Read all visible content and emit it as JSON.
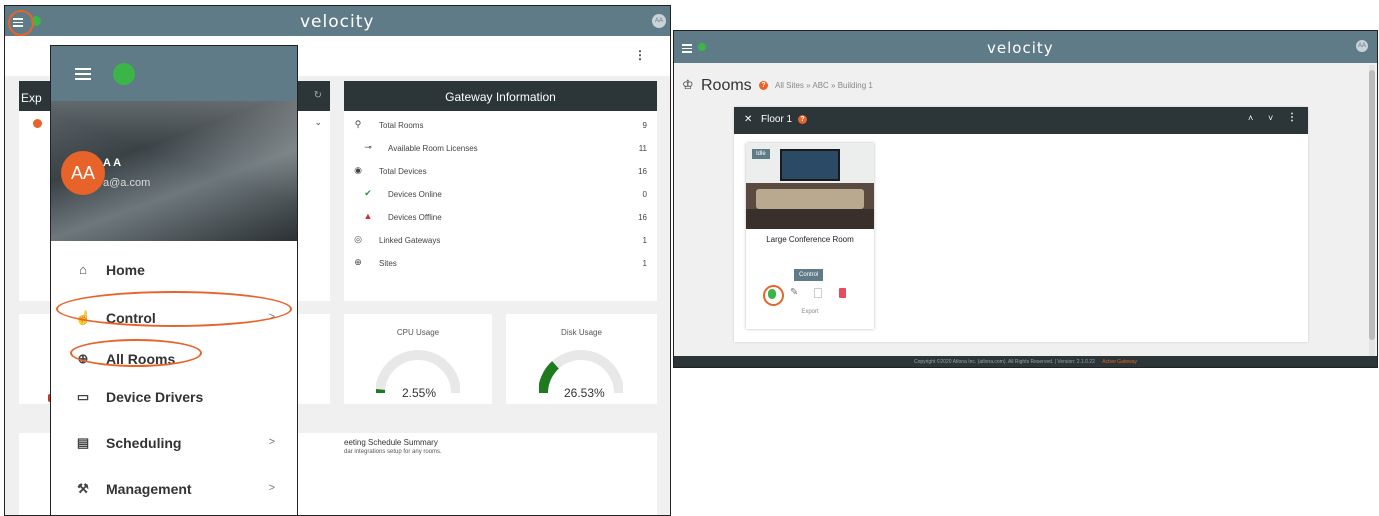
{
  "left": {
    "app_logo": "velocity",
    "avatar_initials": "AA",
    "explorer_title_partial": "Exp",
    "drawer": {
      "avatar_initials": "AA",
      "user_name": "A A",
      "user_email": "a@a.com",
      "items": [
        {
          "label": "Home",
          "icon": "home-icon",
          "chevron": ""
        },
        {
          "label": "Control",
          "icon": "hand-pointer-icon",
          "chevron": ">"
        },
        {
          "label": "All Rooms",
          "icon": "globe-icon",
          "chevron": ""
        },
        {
          "label": "Device Drivers",
          "icon": "device-icon",
          "chevron": ""
        },
        {
          "label": "Scheduling",
          "icon": "calendar-icon",
          "chevron": ">"
        },
        {
          "label": "Management",
          "icon": "wrench-icon",
          "chevron": ">"
        }
      ]
    },
    "gateway": {
      "title": "Gateway Information",
      "rows": [
        {
          "label": "Total Rooms",
          "value": "9",
          "icon": "pin-icon",
          "indent": false
        },
        {
          "label": "Available Room Licenses",
          "value": "11",
          "icon": "key-icon",
          "indent": true
        },
        {
          "label": "Total Devices",
          "value": "16",
          "icon": "devices-icon",
          "indent": false
        },
        {
          "label": "Devices Online",
          "value": "0",
          "icon": "check-circle-icon",
          "indent": true
        },
        {
          "label": "Devices Offline",
          "value": "16",
          "icon": "warning-icon",
          "indent": true
        },
        {
          "label": "Linked Gateways",
          "value": "1",
          "icon": "link-icon",
          "indent": false
        },
        {
          "label": "Sites",
          "value": "1",
          "icon": "globe-icon",
          "indent": false
        }
      ]
    },
    "cpu": {
      "title": "CPU Usage",
      "value": "2.55%",
      "percent": 2.55
    },
    "disk": {
      "title": "Disk Usage",
      "value": "26.53%",
      "percent": 26.53
    },
    "schedule": {
      "title_partial": "eeting Schedule Summary",
      "note_partial": "dar integrations setup for any rooms."
    }
  },
  "right": {
    "app_logo": "velocity",
    "avatar_initials": "AA",
    "page_title": "Rooms",
    "breadcrumb": "All Sites » ABC » Building 1",
    "floor_title": "Floor 1",
    "room": {
      "status": "Idle",
      "name": "Large Conference Room",
      "control_label": "Control",
      "export_label": "Export"
    },
    "footer_text": "Copyright ©2020 Atlona Inc. (atlona.com). All Rights Reserved. | Version: 2.1.0.22",
    "footer_status": "Active Gateway"
  },
  "colors": {
    "topbar": "#5f7b87",
    "accent": "#e8632a",
    "header_dark": "#2c3538",
    "online_green": "#3cb548",
    "gauge_green": "#1f7a1f"
  }
}
